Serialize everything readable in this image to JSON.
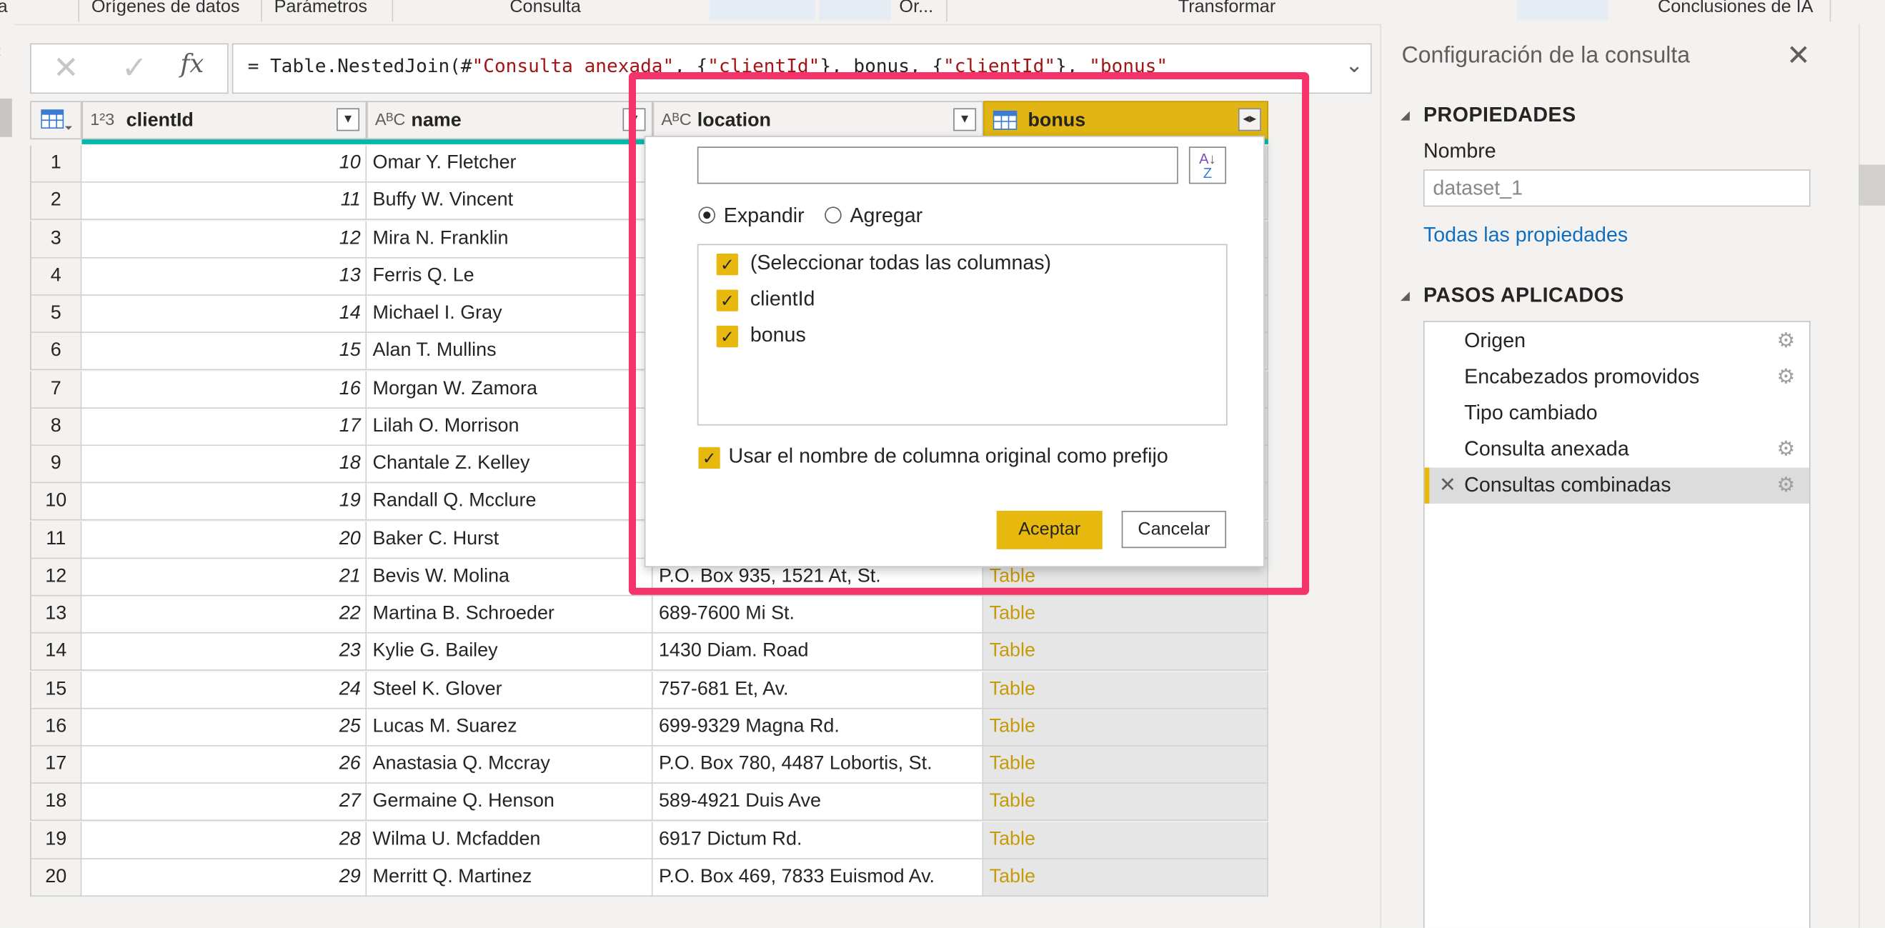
{
  "ribbon": {
    "groups": [
      "a",
      "Orígenes de datos",
      "Parámetros",
      "Consulta",
      "Or...",
      "Transformar",
      "Conclusiones de IA"
    ]
  },
  "formula_bar": {
    "prefix": "= Table.NestedJoin(#",
    "q1": "\"Consulta anexada\"",
    "mid1": ", {",
    "k1": "\"clientId\"",
    "mid2": "}, bonus, {",
    "k2": "\"clientId\"",
    "mid3": "}, ",
    "k3": "\"bonus\"",
    "fx": "fx"
  },
  "columns": [
    {
      "type": "1²3",
      "name": "clientId"
    },
    {
      "type": "AᴮC",
      "name": "name"
    },
    {
      "type": "AᴮC",
      "name": "location"
    },
    {
      "type": "table",
      "name": "bonus"
    }
  ],
  "rows": [
    {
      "idx": "1",
      "id": "10",
      "name": "Omar Y. Fletcher",
      "location": "",
      "bonus": ""
    },
    {
      "idx": "2",
      "id": "11",
      "name": "Buffy W. Vincent",
      "location": "",
      "bonus": ""
    },
    {
      "idx": "3",
      "id": "12",
      "name": "Mira N. Franklin",
      "location": "",
      "bonus": ""
    },
    {
      "idx": "4",
      "id": "13",
      "name": "Ferris Q. Le",
      "location": "",
      "bonus": ""
    },
    {
      "idx": "5",
      "id": "14",
      "name": "Michael I. Gray",
      "location": "",
      "bonus": ""
    },
    {
      "idx": "6",
      "id": "15",
      "name": "Alan T. Mullins",
      "location": "",
      "bonus": ""
    },
    {
      "idx": "7",
      "id": "16",
      "name": "Morgan W. Zamora",
      "location": "",
      "bonus": ""
    },
    {
      "idx": "8",
      "id": "17",
      "name": "Lilah O. Morrison",
      "location": "",
      "bonus": ""
    },
    {
      "idx": "9",
      "id": "18",
      "name": "Chantale Z. Kelley",
      "location": "",
      "bonus": ""
    },
    {
      "idx": "10",
      "id": "19",
      "name": "Randall Q. Mcclure",
      "location": "",
      "bonus": ""
    },
    {
      "idx": "11",
      "id": "20",
      "name": "Baker C. Hurst",
      "location": "",
      "bonus": ""
    },
    {
      "idx": "12",
      "id": "21",
      "name": "Bevis W. Molina",
      "location": "P.O. Box 935, 1521 At, St.",
      "bonus": "Table"
    },
    {
      "idx": "13",
      "id": "22",
      "name": "Martina B. Schroeder",
      "location": "689-7600 Mi St.",
      "bonus": "Table"
    },
    {
      "idx": "14",
      "id": "23",
      "name": "Kylie G. Bailey",
      "location": "1430 Diam. Road",
      "bonus": "Table"
    },
    {
      "idx": "15",
      "id": "24",
      "name": "Steel K. Glover",
      "location": "757-681 Et, Av.",
      "bonus": "Table"
    },
    {
      "idx": "16",
      "id": "25",
      "name": "Lucas M. Suarez",
      "location": "699-9329 Magna Rd.",
      "bonus": "Table"
    },
    {
      "idx": "17",
      "id": "26",
      "name": "Anastasia Q. Mccray",
      "location": "P.O. Box 780, 4487 Lobortis, St.",
      "bonus": "Table"
    },
    {
      "idx": "18",
      "id": "27",
      "name": "Germaine Q. Henson",
      "location": "589-4921 Duis Ave",
      "bonus": "Table"
    },
    {
      "idx": "19",
      "id": "28",
      "name": "Wilma U. Mcfadden",
      "location": "6917 Dictum Rd.",
      "bonus": "Table"
    },
    {
      "idx": "20",
      "id": "29",
      "name": "Merritt Q. Martinez",
      "location": "P.O. Box 469, 7833 Euismod Av.",
      "bonus": "Table"
    }
  ],
  "expand_dialog": {
    "search_value": "",
    "sort_label": "A Z",
    "radio_expand": "Expandir",
    "radio_aggregate": "Agregar",
    "selected_mode": "Expandir",
    "columns": [
      {
        "label": "(Seleccionar todas las columnas)",
        "checked": true
      },
      {
        "label": "clientId",
        "checked": true
      },
      {
        "label": "bonus",
        "checked": true
      }
    ],
    "prefix_label": "Usar el nombre de columna original como prefijo",
    "prefix_checked": true,
    "ok": "Aceptar",
    "cancel": "Cancelar"
  },
  "query_settings": {
    "title": "Configuración de la consulta",
    "properties_header": "PROPIEDADES",
    "name_label": "Nombre",
    "name_value": "dataset_1",
    "all_properties": "Todas las propiedades",
    "steps_header": "PASOS APLICADOS",
    "steps": [
      {
        "label": "Origen",
        "gear": true,
        "selected": false
      },
      {
        "label": "Encabezados promovidos",
        "gear": true,
        "selected": false
      },
      {
        "label": "Tipo cambiado",
        "gear": false,
        "selected": false
      },
      {
        "label": "Consulta anexada",
        "gear": true,
        "selected": false
      },
      {
        "label": "Consultas combinadas",
        "gear": true,
        "selected": true
      }
    ]
  },
  "colors": {
    "accent_yellow": "#e7b90e",
    "highlight_pink": "#f5336b",
    "quality_teal": "#01b8aa",
    "link_blue": "#106ebe"
  }
}
